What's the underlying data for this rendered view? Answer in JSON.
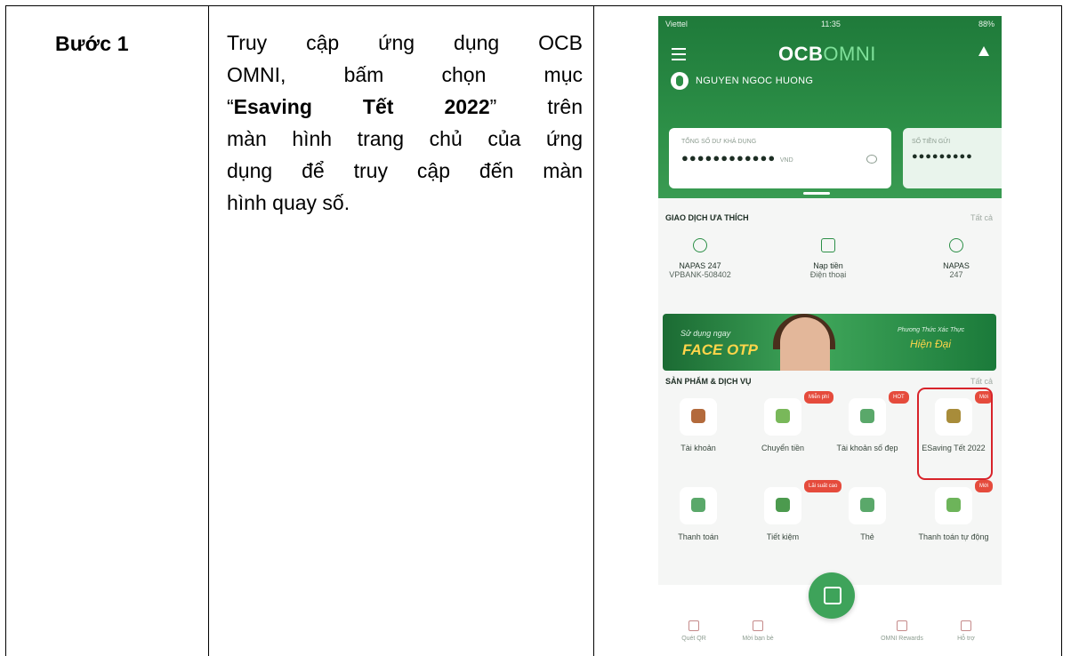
{
  "step": {
    "label": "Bước 1"
  },
  "instruction": {
    "line1": "Truy cập ứng dụng OCB",
    "line2": "OMNI, bấm chọn mục",
    "line3_open": "“",
    "line3_bold": "Esaving Tết 2022",
    "line3_close": "” trên",
    "line4": "màn hình trang chủ của ứng",
    "line5": "dụng để truy cập đến màn",
    "line6": "hình quay số."
  },
  "phone": {
    "status_left": "Viettel",
    "status_time": "11:35",
    "status_right": "88%",
    "logo_main": "OCB",
    "logo_sub": "OMNI",
    "user_name": "NGUYEN NGOC HUONG",
    "balance_caption": "TỔNG SỐ DƯ KHẢ DỤNG",
    "balance_mask": "●●●●●●●●●●●●",
    "balance_currency": "VND",
    "balance2_caption": "SỐ TIỀN GỬI",
    "balance2_mask": "●●●●●●●●●",
    "favorites_title": "GIAO DỊCH ƯA THÍCH",
    "see_all": "Tất cả",
    "favorites": [
      {
        "line1": "NAPAS 247",
        "line2": "VPBANK-508402"
      },
      {
        "line1": "Nạp tiền",
        "line2": "Điện thoại"
      },
      {
        "line1": "NAPAS",
        "line2": "247"
      }
    ],
    "banner_small": "Sử dụng ngay",
    "banner_big": "FACE OTP",
    "banner_right_small": "Phương Thức Xác Thực",
    "banner_right_big": "Hiện Đại",
    "products_title": "SẢN PHẨM & DỊCH VỤ",
    "products": [
      {
        "label": "Tài khoản",
        "tag": ""
      },
      {
        "label": "Chuyển tiền",
        "tag": "Miễn phí"
      },
      {
        "label": "Tài khoản số đẹp",
        "tag": "HOT"
      },
      {
        "label": "ESaving Tết 2022",
        "tag": "Mới"
      },
      {
        "label": "Thanh toán",
        "tag": ""
      },
      {
        "label": "Tiết kiệm",
        "tag": "Lãi suất cao"
      },
      {
        "label": "Thẻ",
        "tag": ""
      },
      {
        "label": "Thanh toán tự động",
        "tag": "Mới"
      }
    ],
    "nav": [
      "Quét QR",
      "Mời bạn bè",
      "OMNI Rewards",
      "Hỗ trợ"
    ]
  },
  "colors": {
    "brand_green": "#2c8f47",
    "highlight_red": "#d8232a"
  }
}
